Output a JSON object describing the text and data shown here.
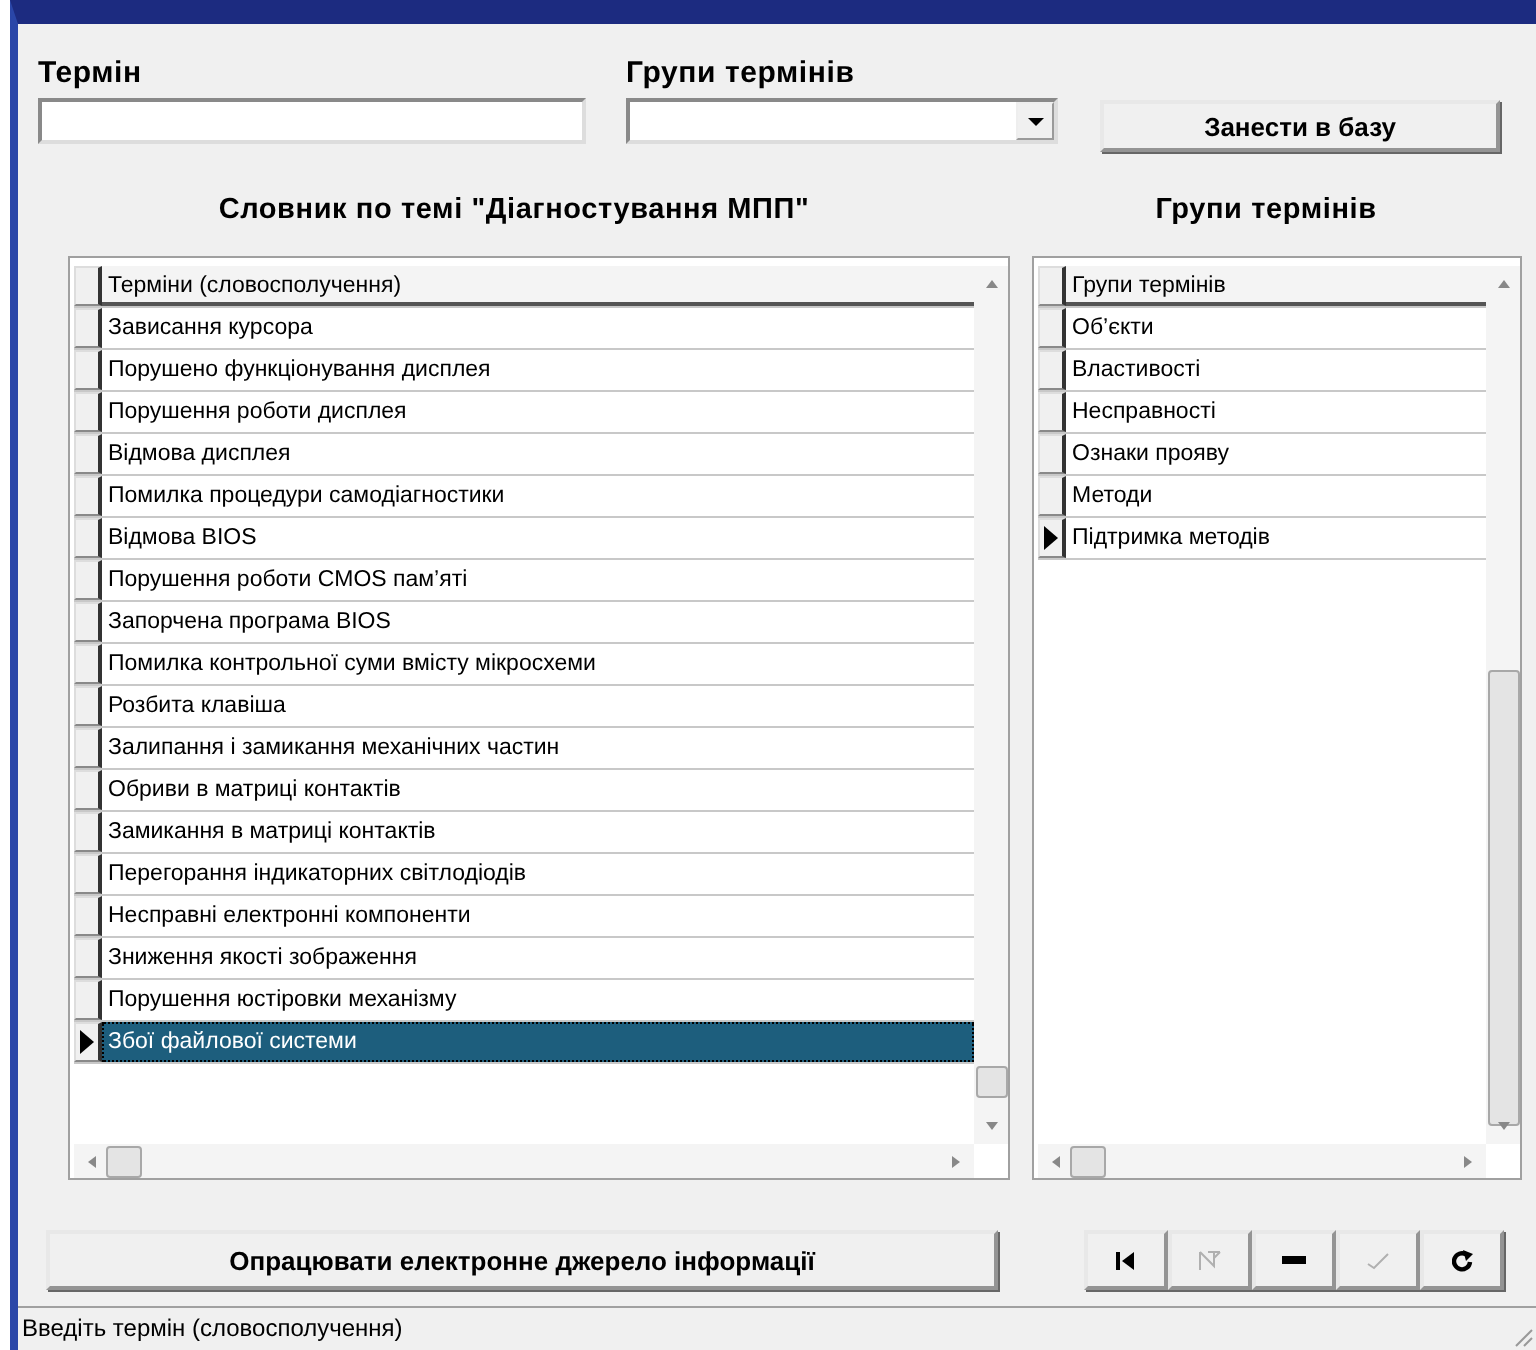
{
  "term_field": {
    "label": "Термін"
  },
  "groups_field": {
    "label": "Групи термінів"
  },
  "save_button": "Занести в базу",
  "dictionary": {
    "title": "Словник по темі \"Діагностування МПП\"",
    "focused": true,
    "header": "Терміни (словосполучення)",
    "rows": [
      {
        "text": "Зависання курсора",
        "selected": false
      },
      {
        "text": "Порушено функціонування дисплея",
        "selected": false
      },
      {
        "text": "Порушення роботи дисплея",
        "selected": false
      },
      {
        "text": "Відмова дисплея",
        "selected": false
      },
      {
        "text": "Помилка процедури самодіагностики",
        "selected": false
      },
      {
        "text": "Відмова BIOS",
        "selected": false
      },
      {
        "text": "Порушення роботи CMOS пам’яті",
        "selected": false
      },
      {
        "text": "Запорчена програма BIOS",
        "selected": false
      },
      {
        "text": "Помилка контрольної суми вмісту мікросхеми",
        "selected": false
      },
      {
        "text": "Розбита клавіша",
        "selected": false
      },
      {
        "text": "Залипання і замикання механічних частин",
        "selected": false
      },
      {
        "text": "Обриви в матриці контактів",
        "selected": false
      },
      {
        "text": "Замикання в матриці контактів",
        "selected": false
      },
      {
        "text": "Перегорання індикаторних світлодіодів",
        "selected": false
      },
      {
        "text": "Несправні електронні компоненти",
        "selected": false
      },
      {
        "text": "Зниження якості зображення",
        "selected": false
      },
      {
        "text": "Порушення юстіровки механізму",
        "selected": false
      },
      {
        "text": "Збої файлової системи",
        "selected": true
      }
    ]
  },
  "groups": {
    "title": "Групи термінів",
    "focused": false,
    "header": "Групи термінів",
    "rows": [
      {
        "text": "Об’єкти",
        "selected": false
      },
      {
        "text": "Властивості",
        "selected": false
      },
      {
        "text": "Несправності",
        "selected": false
      },
      {
        "text": "Ознаки прояву",
        "selected": false
      },
      {
        "text": "Методи",
        "selected": false
      },
      {
        "text": "Підтримка методів",
        "selected": true
      }
    ]
  },
  "process_button": "Опрацювати електронне джерело інформації",
  "navigator": [
    {
      "kind": "first",
      "disabled": false
    },
    {
      "kind": "prior",
      "disabled": true
    },
    {
      "kind": "delete",
      "disabled": false
    },
    {
      "kind": "post",
      "disabled": true
    },
    {
      "kind": "refresh",
      "disabled": false
    }
  ],
  "status_bar": "Введіть термін (словосполучення)"
}
